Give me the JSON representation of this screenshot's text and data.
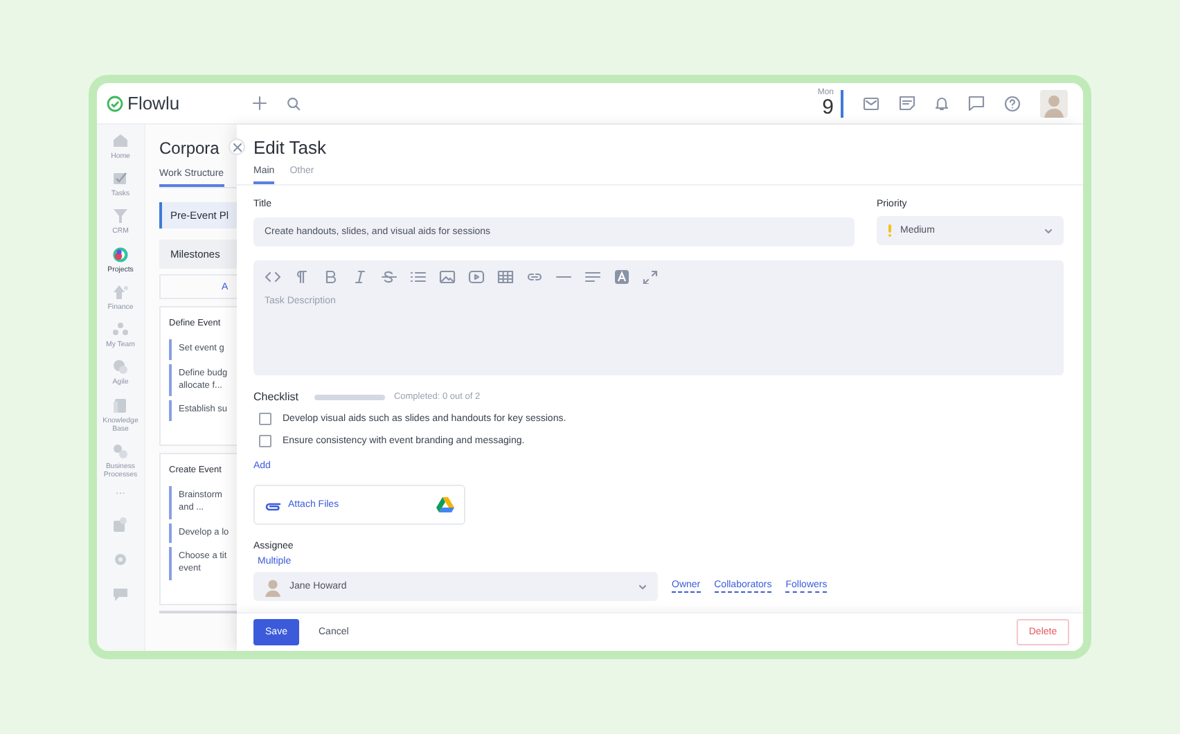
{
  "topbar": {
    "logo": "Flowlu",
    "date": {
      "weekday": "Mon",
      "day": "9"
    }
  },
  "nav": {
    "items": [
      {
        "kind": "home",
        "label": "Home",
        "selected": false
      },
      {
        "kind": "tasks",
        "label": "Tasks",
        "selected": false
      },
      {
        "kind": "crm",
        "label": "CRM",
        "selected": false
      },
      {
        "kind": "projects",
        "label": "Projects",
        "selected": true
      },
      {
        "kind": "finance",
        "label": "Finance",
        "selected": false
      },
      {
        "kind": "team",
        "label": "My Team",
        "selected": false
      },
      {
        "kind": "agile",
        "label": "Agile",
        "selected": false
      },
      {
        "kind": "knowledge",
        "label": "Knowledge Base",
        "selected": false
      },
      {
        "kind": "business",
        "label": "Business Processes",
        "selected": false
      }
    ],
    "more": "···"
  },
  "project": {
    "title": "Corpora",
    "tabs": [
      {
        "label": "Work Structure",
        "selected": true
      }
    ],
    "stage": "Pre-Event Pl",
    "milestones": "Milestones",
    "add_link": "A",
    "cards": [
      {
        "title": "Define Event",
        "items": [
          "Set event g",
          "Define budg allocate f...",
          "Establish su"
        ]
      },
      {
        "title": "Create Event",
        "items": [
          "Brainstorm and ...",
          "Develop a lo",
          "Choose a tit event"
        ]
      }
    ]
  },
  "modal": {
    "title": "Edit Task",
    "tabs": [
      {
        "label": "Main",
        "selected": true
      },
      {
        "label": "Other",
        "selected": false
      }
    ],
    "title_field": {
      "label": "Title",
      "value": "Create handouts, slides, and visual aids for sessions"
    },
    "priority": {
      "label": "Priority",
      "value": "Medium"
    },
    "editor": {
      "placeholder": "Task Description",
      "toolbar": [
        {
          "kind": "code"
        },
        {
          "kind": "paragraph"
        },
        {
          "kind": "bold"
        },
        {
          "kind": "italic"
        },
        {
          "kind": "strike"
        },
        {
          "kind": "list"
        },
        {
          "kind": "image"
        },
        {
          "kind": "video"
        },
        {
          "kind": "table"
        },
        {
          "kind": "link"
        },
        {
          "kind": "rule"
        },
        {
          "kind": "align"
        },
        {
          "kind": "textcolor"
        },
        {
          "kind": "expand"
        }
      ]
    },
    "checklist": {
      "label": "Checklist",
      "level": 0,
      "summary": "Completed: 0 out of 2",
      "items": [
        {
          "text": "Develop visual aids such as slides and handouts for key sessions.",
          "checked": false
        },
        {
          "text": "Ensure consistency with event branding and messaging.",
          "checked": false
        }
      ],
      "add": "Add"
    },
    "attach": "Attach Files",
    "assignee": {
      "label": "Assignee",
      "multiple": "Multiple",
      "value": "Jane Howard",
      "links": [
        "Owner",
        "Collaborators",
        "Followers"
      ]
    },
    "footer": {
      "save": "Save",
      "cancel": "Cancel",
      "delete": "Delete"
    }
  }
}
